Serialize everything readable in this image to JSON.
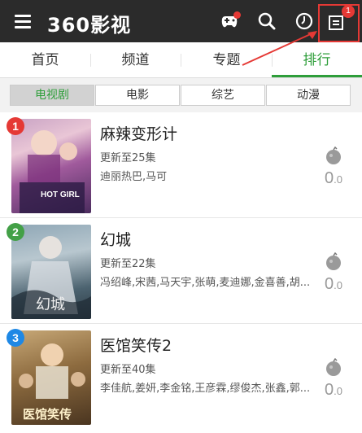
{
  "appbar": {
    "brand": "360影视",
    "download_badge": "1"
  },
  "tabs": [
    "首页",
    "频道",
    "专题",
    "排行"
  ],
  "active_tab": "排行",
  "subtabs": [
    "电视剧",
    "电影",
    "综艺",
    "动漫"
  ],
  "active_subtab": "电视剧",
  "items": [
    {
      "rank": "1",
      "rank_color": "#e53935",
      "title": "麻辣变形计",
      "update": "更新至25集",
      "cast": "迪丽热巴,马可",
      "score_int": "0",
      "score_dec": ".0",
      "poster_text": "HOT GIRL"
    },
    {
      "rank": "2",
      "rank_color": "#43a047",
      "title": "幻城",
      "update": "更新至22集",
      "cast": "冯绍峰,宋茜,马天宇,张萌,麦迪娜,金喜善,胡...",
      "score_int": "0",
      "score_dec": ".0",
      "poster_text": "幻城"
    },
    {
      "rank": "3",
      "rank_color": "#1e88e5",
      "title": "医馆笑传2",
      "update": "更新至40集",
      "cast": "李佳航,姜妍,李金铭,王彦霖,缪俊杰,张鑫,郭...",
      "score_int": "0",
      "score_dec": ".0",
      "poster_text": "医馆笑传"
    }
  ],
  "colors": {
    "accent": "#2e9e3a",
    "bar": "#2b2b2b",
    "annotation": "#e53935"
  }
}
